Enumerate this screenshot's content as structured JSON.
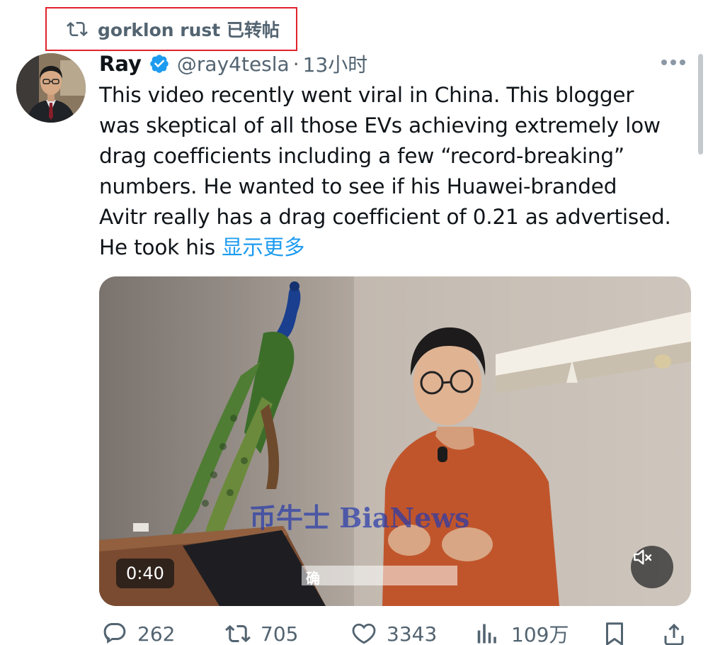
{
  "repost": {
    "text": "gorklon rust 已转帖",
    "icon": "repost-icon"
  },
  "author": {
    "name": "Ray",
    "handle": "@ray4tesla",
    "separator": "·",
    "time": "13小时",
    "verified_color": "#1d9bf0"
  },
  "tweet": {
    "lines": [
      "This video recently went viral in China. This blogger",
      "was skeptical of all those EVs achieving extremely low",
      "drag coefficients including a few “record-breaking”",
      "numbers. He wanted to see if his Huawei-branded",
      "Avitr really has a drag coefficient of 0.21 as advertised."
    ],
    "last_line": "He took his ",
    "show_more": "显示更多"
  },
  "video": {
    "duration": "0:40",
    "watermark": "币牛士 BiaNews",
    "subtitle": "确",
    "muted": true
  },
  "actions": {
    "replies": "262",
    "reposts": "705",
    "likes": "3343",
    "views": "109万"
  },
  "colors": {
    "accent": "#1d9bf0",
    "secondary_text": "#536471",
    "highlight_border": "#e0242b"
  }
}
